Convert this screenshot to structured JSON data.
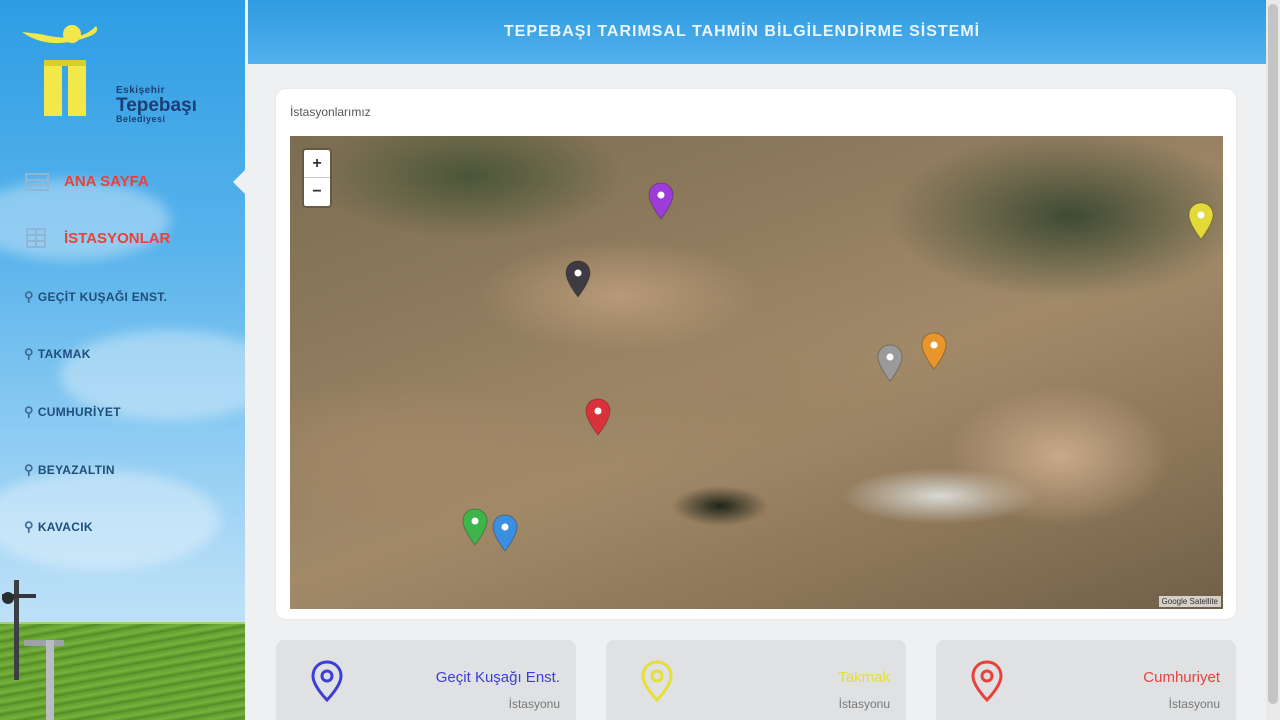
{
  "sidebar": {
    "logo": {
      "line1": "Eskişehir",
      "line2": "Tepebaşı",
      "line3": "Belediyesi"
    },
    "nav_main": [
      {
        "label": "ANA SAYFA",
        "icon": "home-icon"
      },
      {
        "label": "İSTASYONLAR",
        "icon": "stations-icon"
      }
    ],
    "stations": [
      {
        "label": "GEÇİT KUŞAĞI ENST."
      },
      {
        "label": "TAKMAK"
      },
      {
        "label": "CUMHURİYET"
      },
      {
        "label": "BEYAZALTIN"
      },
      {
        "label": "KAVACIK"
      }
    ],
    "colors": {
      "active": "#e8413a",
      "item": "#1f4e7a"
    }
  },
  "header": {
    "title": "TEPEBAŞI TARIMSAL TAHMİN BİLGİLENDİRME SİSTEMİ"
  },
  "map_section": {
    "title": "İstasyonlarımız",
    "zoom_in": "+",
    "zoom_out": "−",
    "attribution": "Google Satellite",
    "marker_colors": [
      "#9b3dd6",
      "#e3d93a",
      "#3e3c42",
      "#9a9a9a",
      "#e8962c",
      "#d9323b",
      "#3eb54b",
      "#3b8fe0"
    ]
  },
  "cards": [
    {
      "name": "Geçit Kuşağı Enst.",
      "sub": "İstasyonu",
      "color": "#3b3fd6"
    },
    {
      "name": "Takmak",
      "sub": "İstasyonu",
      "color": "#e5df36"
    },
    {
      "name": "Cumhuriyet",
      "sub": "İstasyonu",
      "color": "#e8413a"
    }
  ]
}
